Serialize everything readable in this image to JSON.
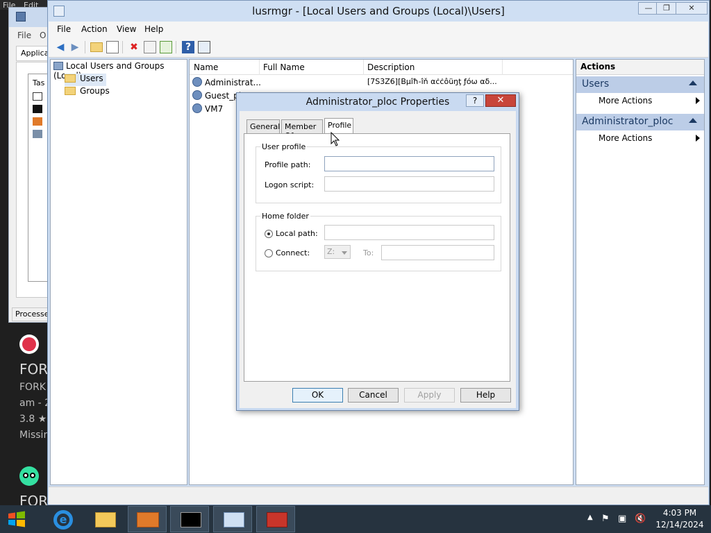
{
  "background": {
    "menu": [
      "File",
      "Edit"
    ],
    "menu_partial": [
      "File",
      "O"
    ],
    "tab_label": "Applica",
    "inner_label": "Tas",
    "status_label": "Processe",
    "listing_title": "FORK",
    "listing_line1": "FORK",
    "listing_line2": "am - 2",
    "rating": "3.8 ★",
    "missing": "Missin",
    "bottom_partial": "FOR"
  },
  "window": {
    "title": "lusrmgr - [Local Users and Groups (Local)\\Users]",
    "controls": {
      "minimize": "—",
      "restore": "❐",
      "close": "✕"
    }
  },
  "menubar": [
    "File",
    "Action",
    "View",
    "Help"
  ],
  "toolbar": {
    "icons": [
      "back-icon",
      "forward-icon",
      "up-folder-icon",
      "show-tree-icon",
      "delete-icon",
      "properties-icon",
      "export-icon",
      "help-icon",
      "action-pane-icon"
    ]
  },
  "tree": {
    "root": "Local Users and Groups (Local)",
    "items": [
      "Users",
      "Groups"
    ],
    "selected": "Users"
  },
  "list": {
    "columns": [
      "Name",
      "Full Name",
      "Description"
    ],
    "rows": [
      {
        "name": "Administrat...",
        "full_name": "",
        "description": "[7S3Z6][Βμîħ-îň αċċôüŋţ ƒóѡ αδ..."
      },
      {
        "name": "Guest_pl",
        "full_name": "",
        "description": ""
      },
      {
        "name": "VM7",
        "full_name": "",
        "description": ""
      }
    ]
  },
  "actions": {
    "header": "Actions",
    "sections": [
      {
        "title": "Users",
        "items": [
          "More Actions"
        ]
      },
      {
        "title": "Administrator_ploc",
        "items": [
          "More Actions"
        ]
      }
    ]
  },
  "dialog": {
    "title": "Administrator_ploc Properties",
    "help": "?",
    "close": "✕",
    "tabs": [
      "General",
      "Member Of",
      "Profile"
    ],
    "active_tab": "Profile",
    "user_profile": {
      "group_label": "User profile",
      "profile_path_label": "Profile path:",
      "profile_path_value": "",
      "logon_script_label": "Logon script:",
      "logon_script_value": ""
    },
    "home_folder": {
      "group_label": "Home folder",
      "local_path_label": "Local path:",
      "local_path_value": "",
      "local_path_selected": true,
      "connect_label": "Connect:",
      "drive_value": "Z:",
      "to_label": "To:",
      "to_value": ""
    },
    "buttons": {
      "ok": "OK",
      "cancel": "Cancel",
      "apply": "Apply",
      "help": "Help"
    }
  },
  "taskbar": {
    "apps": [
      "internet-explorer-icon",
      "file-explorer-icon",
      "package-icon",
      "command-prompt-icon",
      "performance-monitor-icon",
      "toolbox-icon"
    ],
    "tray_icons": [
      "chevron-up-icon",
      "flag-icon",
      "network-icon",
      "volume-muted-icon"
    ],
    "time": "4:03 PM",
    "date": "12/14/2024"
  },
  "colors": {
    "window_frame": "#cdddf2",
    "section_header": "#bccde7",
    "close_button": "#c8453a",
    "taskbar": "#26333f"
  }
}
